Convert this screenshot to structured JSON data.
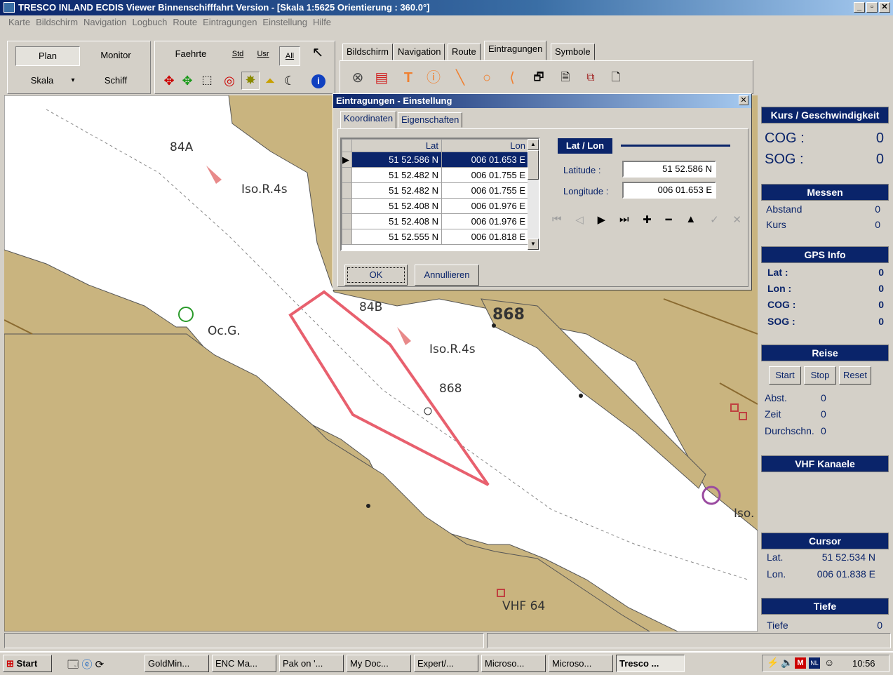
{
  "window": {
    "title": "TRESCO INLAND ECDIS Viewer Binnenschifffahrt Version - [Skala 1:5625 Orientierung : 360.0°]",
    "controls": [
      "_",
      "▫",
      "✕"
    ]
  },
  "menu": [
    "Karte",
    "Bildschirm",
    "Navigation",
    "Logbuch",
    "Route",
    "Eintragungen",
    "Einstellung",
    "Hilfe"
  ],
  "toolbar": {
    "plan": "Plan",
    "monitor": "Monitor",
    "skala": "Skala",
    "schiff": "Schiff",
    "faehrte": "Faehrte",
    "std": "Std",
    "usr": "Usr",
    "all": "All"
  },
  "tabs": [
    "Bildschirm",
    "Navigation",
    "Route",
    "Eintragungen",
    "Symbole"
  ],
  "active_tab": "Eintragungen",
  "map": {
    "labels": [
      "84A",
      "Iso.R.4s",
      "Oc.G.",
      "84B",
      "868",
      "Iso.R.4s",
      "868",
      "VHF 64",
      "Iso."
    ]
  },
  "dialog": {
    "title": "Eintragungen - Einstellung",
    "tabs": [
      "Koordinaten",
      "Eigenschaften"
    ],
    "columns": [
      "Lat",
      "Lon"
    ],
    "rows": [
      {
        "lat": "51 52.586 N",
        "lon": "006 01.653 E"
      },
      {
        "lat": "51 52.482 N",
        "lon": "006 01.755 E"
      },
      {
        "lat": "51 52.482 N",
        "lon": "006 01.755 E"
      },
      {
        "lat": "51 52.408 N",
        "lon": "006 01.976 E"
      },
      {
        "lat": "51 52.408 N",
        "lon": "006 01.976 E"
      },
      {
        "lat": "51 52.555 N",
        "lon": "006 01.818 E"
      }
    ],
    "latlon_label": "Lat / Lon",
    "latitude_label": "Latitude :",
    "latitude_value": "51 52.586 N",
    "longitude_label": "Longitude :",
    "longitude_value": "006 01.653 E",
    "ok": "OK",
    "cancel": "Annullieren"
  },
  "panel": {
    "kurs": {
      "title": "Kurs /  Geschwindigkeit",
      "cog_label": "COG :",
      "cog": "0",
      "sog_label": "SOG :",
      "sog": "0"
    },
    "messen": {
      "title": "Messen",
      "abstand_label": "Abstand",
      "abstand": "0",
      "kurs_label": "Kurs",
      "kurs": "0"
    },
    "gps": {
      "title": "GPS Info",
      "lat_label": "Lat :",
      "lat": "0",
      "lon_label": "Lon :",
      "lon": "0",
      "cog_label": "COG :",
      "cog": "0",
      "sog_label": "SOG :",
      "sog": "0"
    },
    "reise": {
      "title": "Reise",
      "start": "Start",
      "stop": "Stop",
      "reset": "Reset",
      "abst_label": "Abst.",
      "abst": "0",
      "zeit_label": "Zeit",
      "zeit": "0",
      "durch_label": "Durchschn.",
      "durch": "0"
    },
    "vhf": {
      "title": "VHF Kanaele"
    },
    "cursor": {
      "title": "Cursor",
      "lat_label": "Lat.",
      "lat": "51 52.534 N",
      "lon_label": "Lon.",
      "lon": "006 01.838 E"
    },
    "tiefe": {
      "title": "Tiefe",
      "label": "Tiefe",
      "value": "0"
    }
  },
  "taskbar": {
    "start": "Start",
    "tasks": [
      "GoldMin...",
      "ENC Ma...",
      "Pak on '...",
      "My Doc...",
      "Expert/...",
      "Microso...",
      "Microso...",
      "Tresco ..."
    ],
    "clock": "10:56"
  },
  "colors": {
    "land": "#c9b47f",
    "water": "#ffffff",
    "route": "#e8606e",
    "titlebar": "#0a246a"
  }
}
